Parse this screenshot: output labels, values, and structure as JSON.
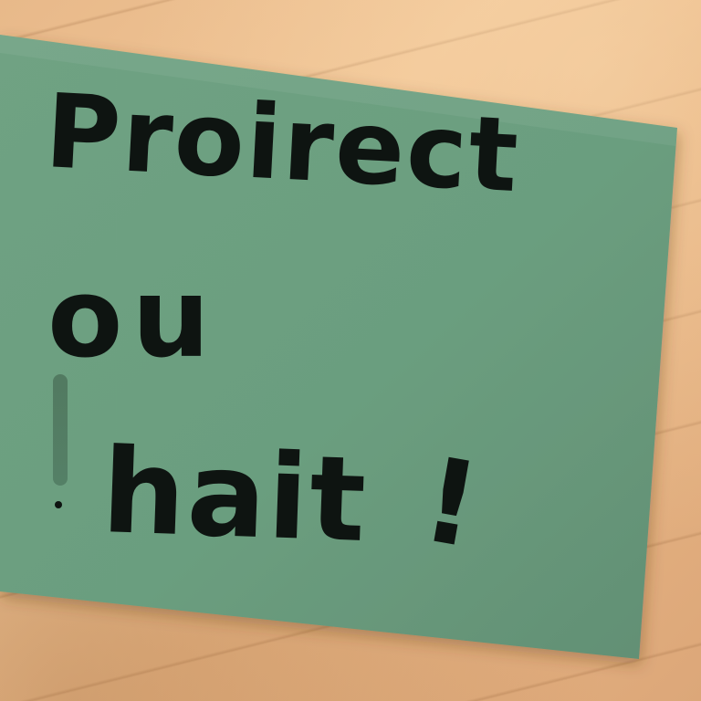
{
  "scene": {
    "description_colors": {
      "paper_green": "#6b9e7f",
      "paper_edge": "#5c8e70",
      "ink": "#0e1411",
      "wood": "#e8b98a"
    }
  },
  "note": {
    "line_1": "Proirect",
    "line_2": "ou",
    "line_3_word": "hait",
    "line_3_mark": "!"
  }
}
